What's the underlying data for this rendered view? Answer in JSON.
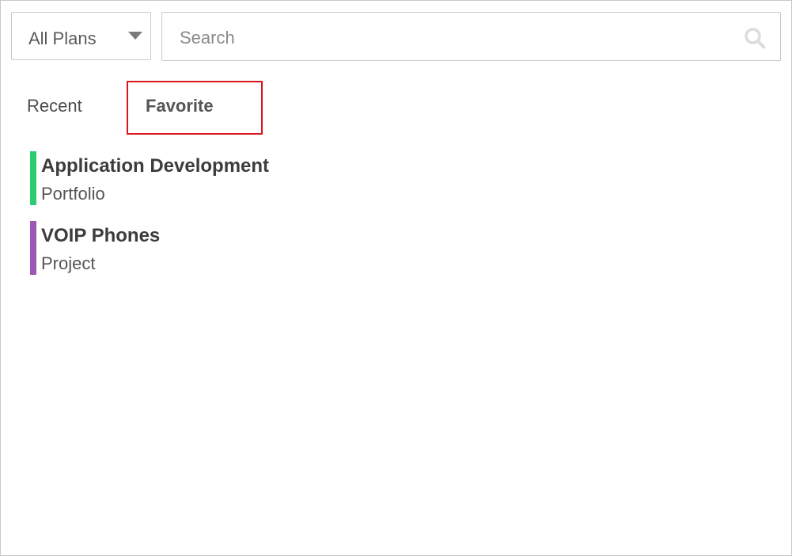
{
  "filter": {
    "selected": "All Plans",
    "caret_icon": "caret-down-icon"
  },
  "search": {
    "placeholder": "Search",
    "value": "",
    "icon": "search-icon"
  },
  "tabs": [
    {
      "label": "Recent",
      "active": false
    },
    {
      "label": "Favorite",
      "active": true
    }
  ],
  "items": [
    {
      "title": "Application Development",
      "subtitle": "Portfolio",
      "color": "#2ecc71"
    },
    {
      "title": "VOIP Phones",
      "subtitle": "Project",
      "color": "#9b59b6"
    }
  ],
  "colors": {
    "highlight_border": "#d9141c"
  }
}
